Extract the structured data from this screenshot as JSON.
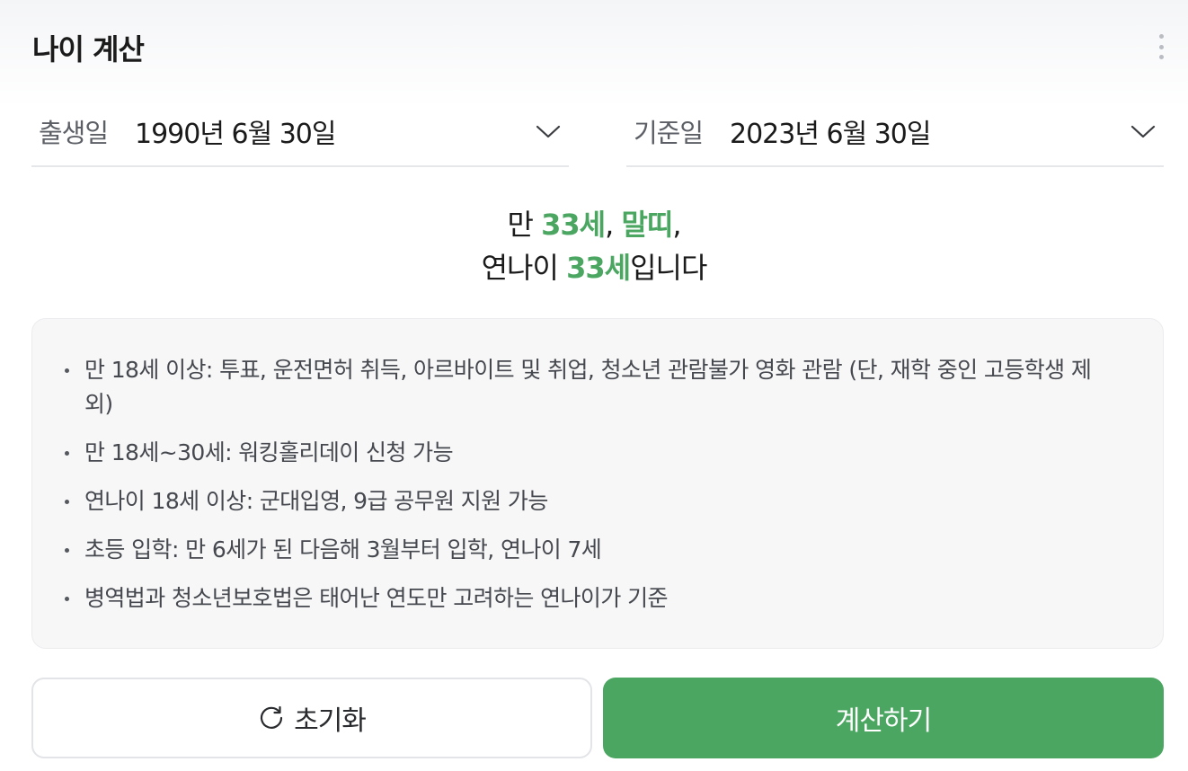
{
  "header": {
    "title": "나이 계산",
    "menu_icon": "more-vertical-icon"
  },
  "birth_date": {
    "label": "출생일",
    "value": "1990년 6월 30일",
    "icon": "chevron-down-icon"
  },
  "base_date": {
    "label": "기준일",
    "value": "2023년 6월 30일",
    "icon": "chevron-down-icon"
  },
  "result": {
    "line1_prefix": "만 ",
    "full_age": "33세",
    "sep1": ", ",
    "zodiac": "말띠",
    "sep2": ",",
    "line2_prefix": "연나이 ",
    "korean_age": "33세",
    "line2_suffix": "입니다"
  },
  "info": {
    "items": [
      "만 18세 이상: 투표, 운전면허 취득, 아르바이트 및 취업, 청소년 관람불가 영화 관람 (단, 재학 중인 고등학생 제외)",
      "만 18세~30세: 워킹홀리데이 신청 가능",
      "연나이 18세 이상: 군대입영, 9급 공무원 지원 가능",
      "초등 입학: 만 6세가 된 다음해 3월부터 입학, 연나이 7세",
      "병역법과 청소년보호법은 태어난 연도만 고려하는 연나이가 기준"
    ]
  },
  "buttons": {
    "reset_label": "초기화",
    "reset_icon": "refresh-icon",
    "calculate_label": "계산하기"
  },
  "colors": {
    "accent": "#4ba661",
    "text": "#1b1b1b",
    "muted": "#5c5f66"
  }
}
